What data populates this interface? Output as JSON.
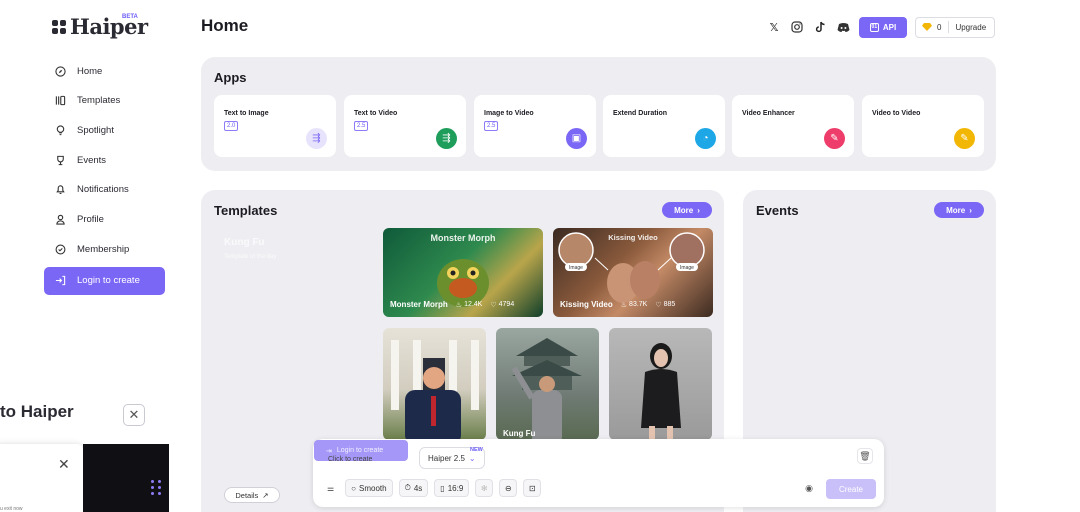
{
  "brand": {
    "name": "Haiper",
    "badge": "BETA"
  },
  "sidebar": {
    "items": [
      {
        "label": "Home",
        "icon": "compass-icon"
      },
      {
        "label": "Templates",
        "icon": "templates-icon"
      },
      {
        "label": "Spotlight",
        "icon": "bulb-icon"
      },
      {
        "label": "Events",
        "icon": "trophy-icon"
      },
      {
        "label": "Notifications",
        "icon": "bell-icon"
      },
      {
        "label": "Profile",
        "icon": "user-icon"
      },
      {
        "label": "Membership",
        "icon": "badge-icon"
      },
      {
        "label": "Login to create",
        "icon": "login-icon"
      }
    ]
  },
  "header": {
    "title": "Home",
    "social": [
      "x-icon",
      "instagram-icon",
      "tiktok-icon",
      "discord-icon"
    ],
    "api_label": "API",
    "credits": "0",
    "upgrade_label": "Upgrade"
  },
  "apps": {
    "title": "Apps",
    "items": [
      {
        "name": "Text to Image",
        "version": "2.0",
        "color": "#e7e3fd",
        "icon_color": "#7b67f5"
      },
      {
        "name": "Text to Video",
        "version": "2.5",
        "color": "#1f9d5b",
        "icon_color": "#ffffff"
      },
      {
        "name": "Image to Video",
        "version": "2.5",
        "color": "#7b67f5",
        "icon_color": "#ffffff"
      },
      {
        "name": "Extend Duration",
        "version": "",
        "color": "#1da7e6",
        "icon_color": "#ffffff"
      },
      {
        "name": "Video Enhancer",
        "version": "",
        "color": "#ee3d6a",
        "icon_color": "#ffffff"
      },
      {
        "name": "Video to Video",
        "version": "",
        "color": "#f2b705",
        "icon_color": "#ffffff"
      }
    ]
  },
  "templates": {
    "title": "Templates",
    "more_label": "More",
    "feature": {
      "title": "Kung Fu",
      "subtitle": "Template of the day",
      "details_label": "Details"
    },
    "cards": [
      {
        "title_top": "Monster Morph",
        "name": "Monster Morph",
        "views": "12.4K",
        "likes": "4794"
      },
      {
        "title_top": "Kissing Video",
        "name": "Kissing Video",
        "views": "83.7K",
        "likes": "885"
      },
      {
        "name": ""
      },
      {
        "name": "Kung Fu"
      },
      {
        "name": ""
      }
    ]
  },
  "events": {
    "title": "Events",
    "more_label": "More"
  },
  "welcome": {
    "text": "to Haiper",
    "popup_text": "u exit now"
  },
  "create_bar": {
    "login_label": "Login to create",
    "click_hint": "Click to create",
    "model": "Haiper 2.5",
    "new_tag": "NEW",
    "options": {
      "motion": "Smooth",
      "duration": "4s",
      "ratio": "16:9"
    },
    "create_label": "Create"
  },
  "colors": {
    "accent": "#7b67f5",
    "panel": "#eeeef2"
  }
}
